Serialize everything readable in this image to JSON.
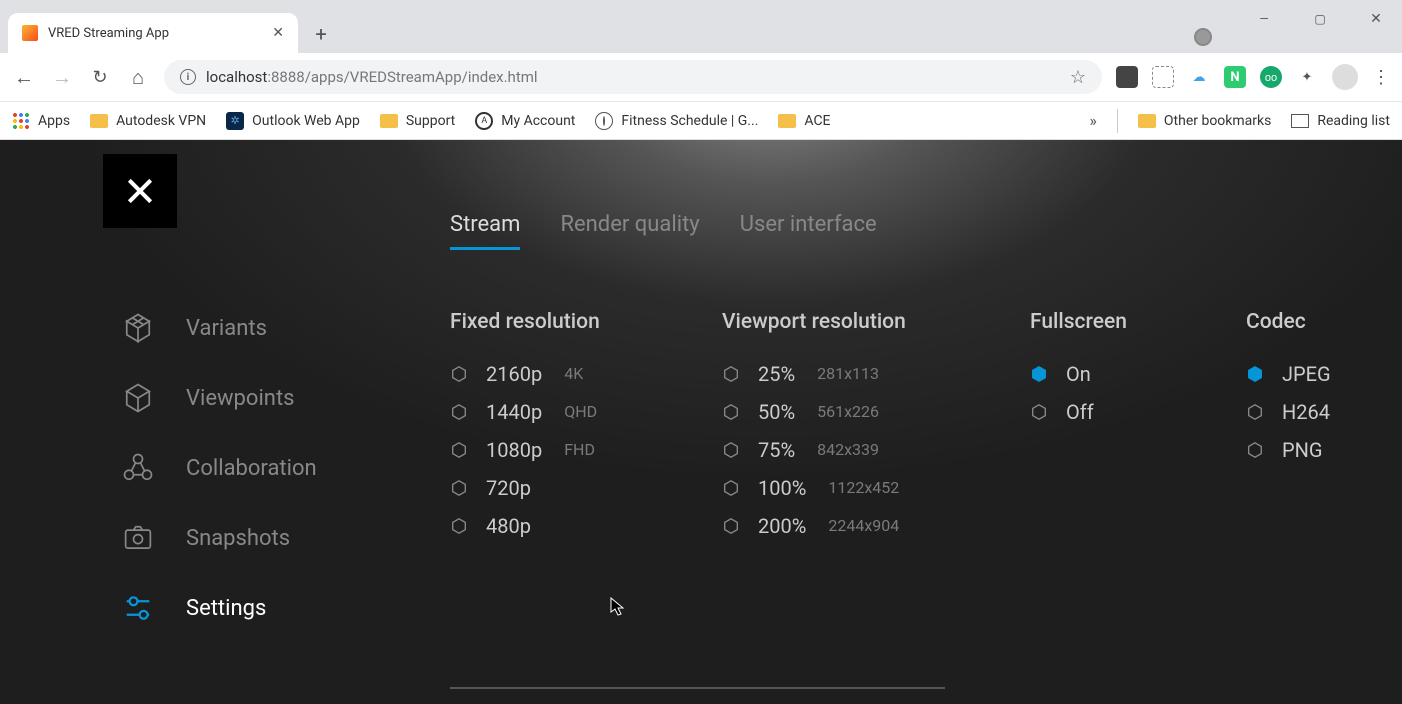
{
  "browser": {
    "tab_title": "VRED Streaming App",
    "url_host": "localhost",
    "url_port": ":8888",
    "url_path": "/apps/VREDStreamApp/index.html",
    "bookmarks": {
      "apps": "Apps",
      "vpn": "Autodesk VPN",
      "outlook": "Outlook Web App",
      "support": "Support",
      "account": "My Account",
      "fitness": "Fitness Schedule | G...",
      "ace": "ACE",
      "other": "Other bookmarks",
      "reading": "Reading list"
    }
  },
  "app": {
    "tabs": {
      "stream": "Stream",
      "render": "Render quality",
      "ui": "User interface"
    },
    "sidebar": {
      "variants": "Variants",
      "viewpoints": "Viewpoints",
      "collaboration": "Collaboration",
      "snapshots": "Snapshots",
      "settings": "Settings"
    },
    "headings": {
      "fixed": "Fixed resolution",
      "viewport": "Viewport resolution",
      "fullscreen": "Fullscreen",
      "codec": "Codec"
    },
    "fixed_res": [
      {
        "label": "2160p",
        "sub": "4K"
      },
      {
        "label": "1440p",
        "sub": "QHD"
      },
      {
        "label": "1080p",
        "sub": "FHD"
      },
      {
        "label": "720p",
        "sub": ""
      },
      {
        "label": "480p",
        "sub": ""
      }
    ],
    "viewport_res": [
      {
        "label": "25%",
        "sub": "281x113"
      },
      {
        "label": "50%",
        "sub": "561x226"
      },
      {
        "label": "75%",
        "sub": "842x339"
      },
      {
        "label": "100%",
        "sub": "1122x452"
      },
      {
        "label": "200%",
        "sub": "2244x904"
      }
    ],
    "fullscreen": [
      {
        "label": "On",
        "selected": true
      },
      {
        "label": "Off",
        "selected": false
      }
    ],
    "codec": [
      {
        "label": "JPEG",
        "selected": true
      },
      {
        "label": "H264",
        "selected": false
      },
      {
        "label": "PNG",
        "selected": false
      }
    ]
  }
}
